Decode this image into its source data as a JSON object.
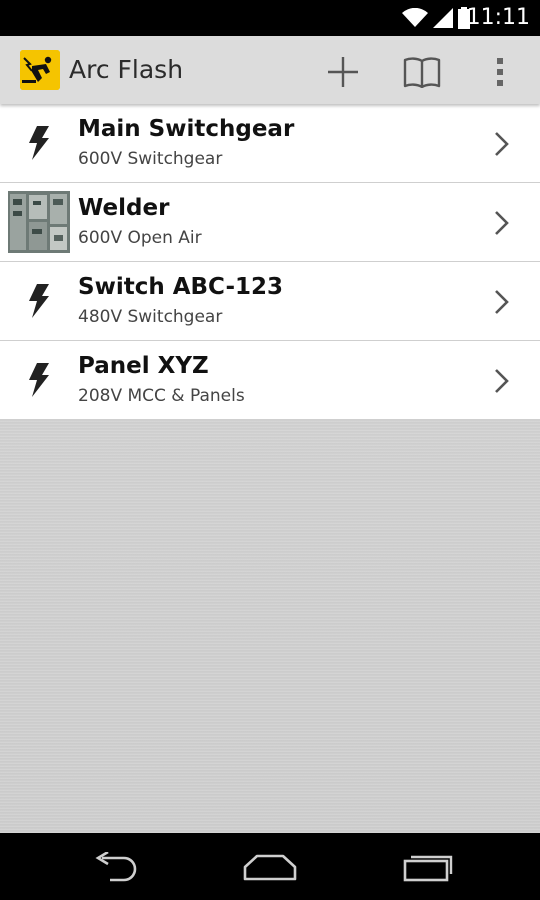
{
  "status_bar": {
    "time": "11:11"
  },
  "action_bar": {
    "title": "Arc Flash",
    "actions": [
      {
        "name": "add",
        "icon": "plus-icon"
      },
      {
        "name": "reference",
        "icon": "book-icon"
      },
      {
        "name": "more",
        "icon": "overflow-menu-icon"
      }
    ]
  },
  "equipment_list": [
    {
      "title": "Main Switchgear",
      "subtitle": "600V Switchgear",
      "leading": "lightning-bolt-icon"
    },
    {
      "title": "Welder",
      "subtitle": "600V Open Air",
      "leading": "photo-thumbnail"
    },
    {
      "title": "Switch ABC-123",
      "subtitle": "480V Switchgear",
      "leading": "lightning-bolt-icon"
    },
    {
      "title": "Panel XYZ",
      "subtitle": "208V MCC & Panels",
      "leading": "lightning-bolt-icon"
    }
  ],
  "colors": {
    "action_bar_bg": "#dcdcdc",
    "app_icon_bg": "#f5c400",
    "list_bg": "#ffffff",
    "background": "#d0d0d0"
  }
}
